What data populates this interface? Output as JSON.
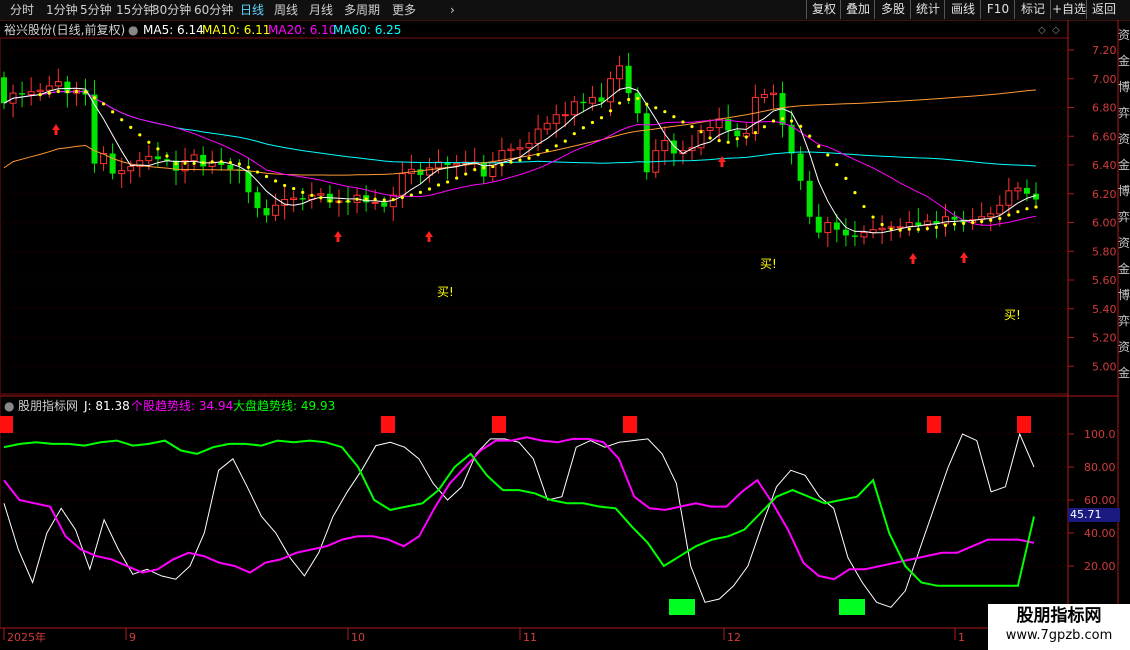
{
  "toolbar": {
    "period_tabs": [
      "分时",
      "1分钟",
      "5分钟",
      "15分钟",
      "30分钟",
      "60分钟",
      "日线",
      "周线",
      "月线",
      "多周期",
      "更多"
    ],
    "active_tab": "日线",
    "right_buttons": [
      "复权",
      "叠加",
      "多股",
      "统计",
      "画线",
      "F10",
      "标记",
      "+自选",
      "返回"
    ]
  },
  "main_chart": {
    "stock_title": "裕兴股份(日线,前复权)",
    "ma5_label": "MA5: 6.14",
    "ma10_label": "MA10: 6.11",
    "ma20_label": "MA20: 6.10",
    "ma60_label": "MA60: 6.25",
    "y_ticks": [
      "7.20",
      "7.00",
      "6.80",
      "6.60",
      "6.40",
      "6.20",
      "6.00",
      "5.80",
      "5.60",
      "5.40",
      "5.20",
      "5.00"
    ],
    "buy_label": "买!",
    "colors": {
      "up": "#ff3232",
      "down": "#00e600",
      "ma5": "#ffffff",
      "ma10": "#ffff00",
      "ma20": "#ff00ff",
      "ma60": "#00ffff",
      "ma_long": "#ff9932"
    }
  },
  "indicator": {
    "title": "股朋指标网",
    "j_label": "J: 81.38",
    "stock_trend_label": "个股趋势线: 34.94",
    "market_trend_label": "大盘趋势线: 49.93",
    "y_ticks": [
      "100.0",
      "80.00",
      "60.00",
      "40.00",
      "20.00"
    ],
    "cursor_value": "45.71"
  },
  "x_axis": {
    "labels": [
      "2025年",
      "9",
      "10",
      "11",
      "12",
      "1"
    ]
  },
  "right_panel_text": "资金博弈",
  "watermark": {
    "name": "股朋指标网",
    "url": "www.7gpzb.com"
  }
}
